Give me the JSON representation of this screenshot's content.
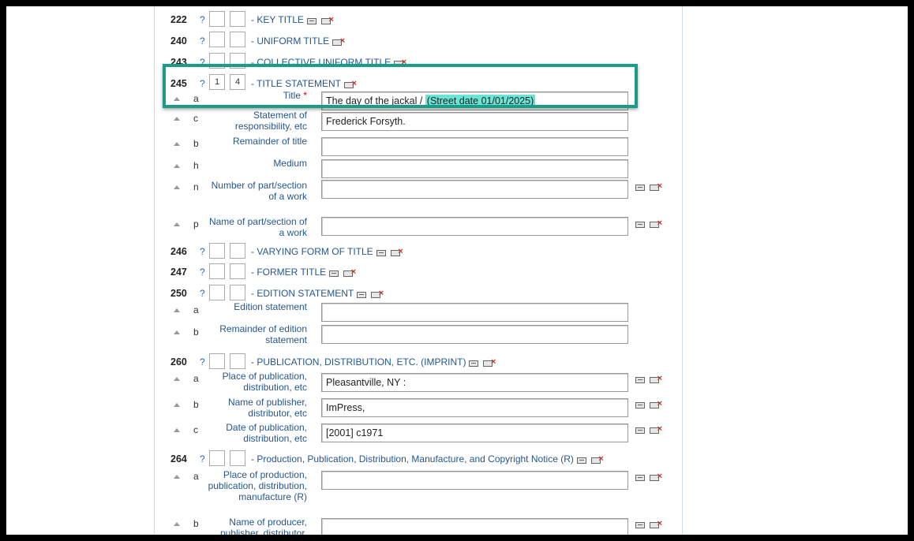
{
  "fields": {
    "f222": {
      "tag": "222",
      "help": "?",
      "ind1": "",
      "ind2": "",
      "title": "- KEY TITLE"
    },
    "f240": {
      "tag": "240",
      "help": "?",
      "ind1": "",
      "ind2": "",
      "title": "- UNIFORM TITLE"
    },
    "f243": {
      "tag": "243",
      "help": "?",
      "ind1": "",
      "ind2": "",
      "title": "- COLLECTIVE UNIFORM TITLE"
    },
    "f245": {
      "tag": "245",
      "help": "?",
      "ind1": "1",
      "ind2": "4",
      "title": "- TITLE STATEMENT",
      "subfields": [
        {
          "code": "a",
          "label": "Title",
          "required": "*",
          "value": "The day of the jackal /",
          "highlight": "(Street date 01/01/2025)"
        },
        {
          "code": "c",
          "label": "Statement of responsibility, etc",
          "value": "Frederick Forsyth."
        },
        {
          "code": "b",
          "label": "Remainder of title",
          "value": ""
        },
        {
          "code": "h",
          "label": "Medium",
          "value": ""
        },
        {
          "code": "n",
          "label": "Number of part/section of a work",
          "value": ""
        },
        {
          "code": "p",
          "label": "Name of part/section of a work",
          "value": ""
        }
      ]
    },
    "f246": {
      "tag": "246",
      "help": "?",
      "ind1": "",
      "ind2": "",
      "title": "- VARYING FORM OF TITLE"
    },
    "f247": {
      "tag": "247",
      "help": "?",
      "ind1": "",
      "ind2": "",
      "title": "- FORMER TITLE"
    },
    "f250": {
      "tag": "250",
      "help": "?",
      "ind1": "",
      "ind2": "",
      "title": "- EDITION STATEMENT",
      "subfields": [
        {
          "code": "a",
          "label": "Edition statement",
          "value": ""
        },
        {
          "code": "b",
          "label": "Remainder of edition statement",
          "value": ""
        }
      ]
    },
    "f260": {
      "tag": "260",
      "help": "?",
      "ind1": "",
      "ind2": "",
      "title": "- PUBLICATION, DISTRIBUTION, ETC. (IMPRINT)",
      "subfields": [
        {
          "code": "a",
          "label": "Place of publication, distribution, etc",
          "value": "Pleasantville, NY :"
        },
        {
          "code": "b",
          "label": "Name of publisher, distributor, etc",
          "value": "ImPress,"
        },
        {
          "code": "c",
          "label": "Date of publication, distribution, etc",
          "value": "[2001] c1971"
        }
      ]
    },
    "f264": {
      "tag": "264",
      "help": "?",
      "ind1": "",
      "ind2": "",
      "title": "- Production, Publication, Distribution, Manufacture, and Copyright Notice (R)",
      "subfields": [
        {
          "code": "a",
          "label": "Place of production, publication, distribution, manufacture (R)",
          "value": ""
        },
        {
          "code": "b",
          "label": "Name of producer, publisher, distributor,",
          "value": ""
        }
      ]
    }
  }
}
